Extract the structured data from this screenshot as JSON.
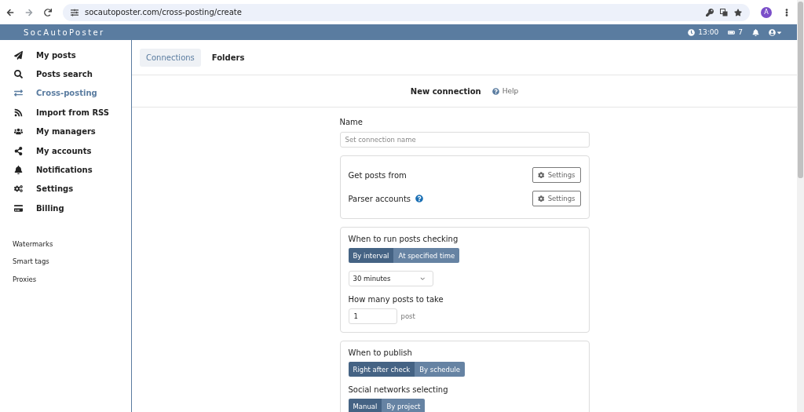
{
  "browser": {
    "url": "socautoposter.com/cross-posting/create",
    "avatar": "A"
  },
  "header": {
    "brand": "SocAutoPoster",
    "time": "13:00",
    "count": "7"
  },
  "sidebar": {
    "items": [
      {
        "label": "My posts",
        "selected": false
      },
      {
        "label": "Posts search",
        "selected": false
      },
      {
        "label": "Cross-posting",
        "selected": true
      },
      {
        "label": "Import from RSS",
        "selected": false
      },
      {
        "label": "My managers",
        "selected": false
      },
      {
        "label": "My accounts",
        "selected": false
      },
      {
        "label": "Notifications",
        "selected": false
      },
      {
        "label": "Settings",
        "selected": false
      },
      {
        "label": "Billing",
        "selected": false
      }
    ],
    "links": [
      "Watermarks",
      "Smart tags",
      "Proxies"
    ]
  },
  "tabs": [
    {
      "label": "Connections",
      "selected": true
    },
    {
      "label": "Folders",
      "selected": false
    }
  ],
  "page": {
    "title": "New connection",
    "help": "Help"
  },
  "form": {
    "name_label": "Name",
    "name_placeholder": "Set connection name",
    "sources": [
      {
        "label": "Get posts from",
        "help": false,
        "button": "Settings"
      },
      {
        "label": "Parser accounts",
        "help": true,
        "button": "Settings"
      }
    ],
    "checking": {
      "title": "When to run posts checking",
      "modes": [
        {
          "label": "By interval",
          "selected": true
        },
        {
          "label": "At specified time",
          "selected": false
        }
      ],
      "interval": "30 minutes",
      "count_label": "How many posts to take",
      "count_value": "1",
      "count_unit": "post"
    },
    "publish": {
      "title": "When to publish",
      "modes": [
        {
          "label": "Right after check",
          "selected": true
        },
        {
          "label": "By schedule",
          "selected": false
        }
      ],
      "networks_title": "Social networks selecting",
      "network_modes": [
        {
          "label": "Manual",
          "selected": true
        },
        {
          "label": "By project",
          "selected": false
        }
      ]
    }
  }
}
